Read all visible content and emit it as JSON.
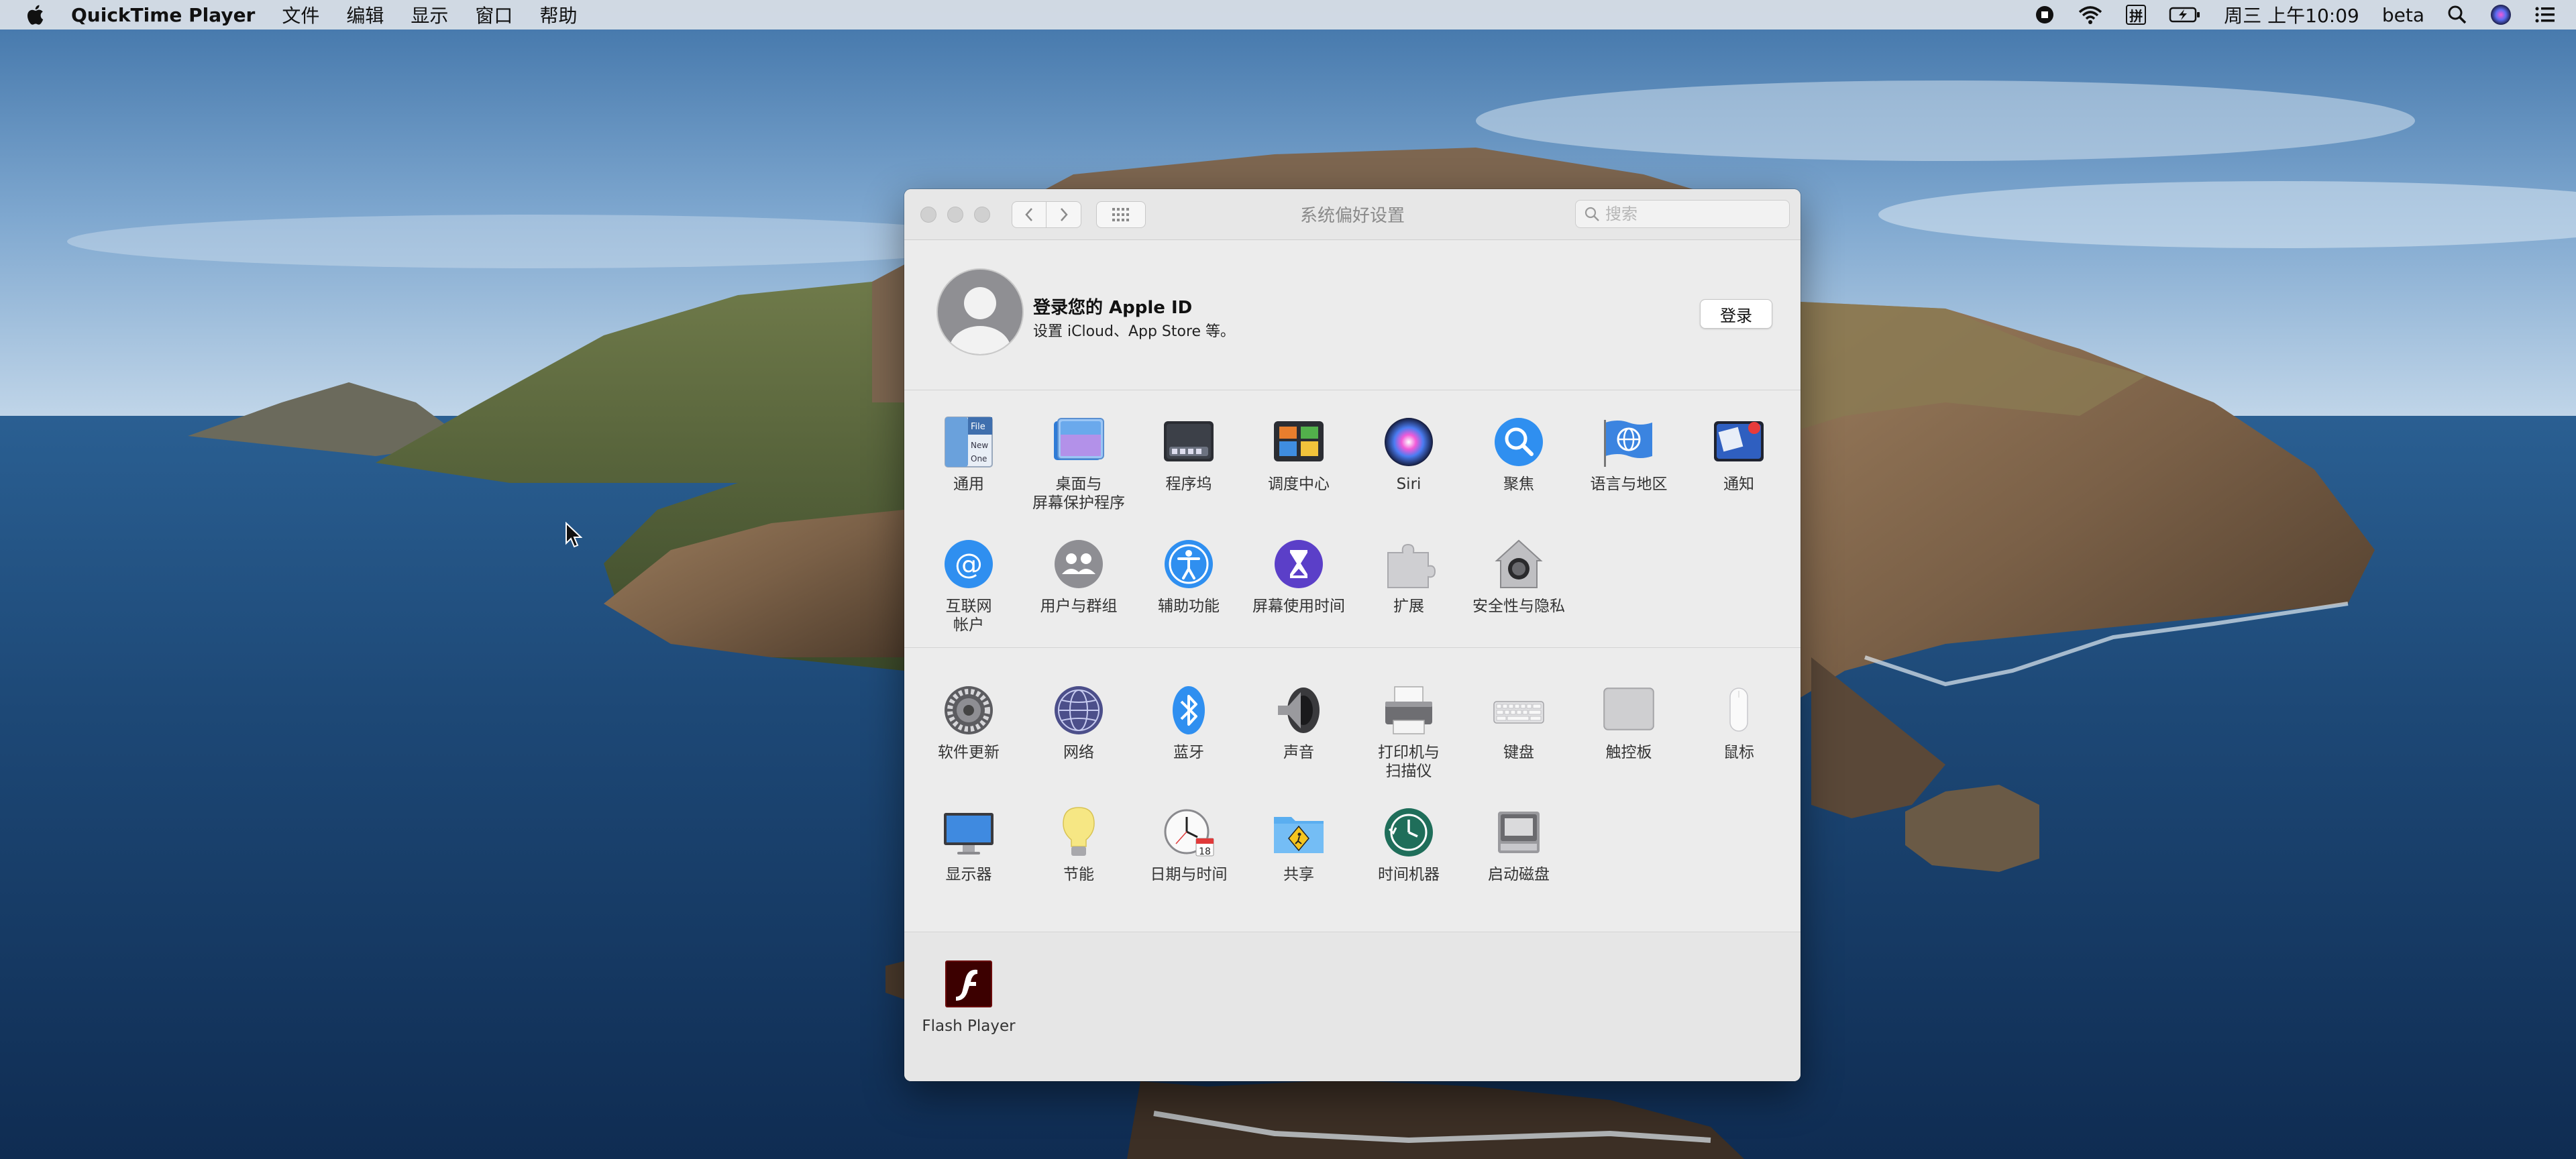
{
  "menubar": {
    "app_name": "QuickTime Player",
    "menus": [
      "文件",
      "编辑",
      "显示",
      "窗口",
      "帮助"
    ],
    "input_method": "拼",
    "clock": "周三 上午10:09",
    "user": "beta"
  },
  "window": {
    "title": "系统偏好设置",
    "search_placeholder": "搜索"
  },
  "apple_id": {
    "title": "登录您的 Apple ID",
    "subtitle": "设置 iCloud、App Store 等。",
    "login_label": "登录"
  },
  "prefs_row1": [
    "通用",
    "桌面与\n屏幕保护程序",
    "程序坞",
    "调度中心",
    "Siri",
    "聚焦",
    "语言与地区",
    "通知"
  ],
  "prefs_row2": [
    "互联网\n帐户",
    "用户与群组",
    "辅助功能",
    "屏幕使用时间",
    "扩展",
    "安全性与隐私"
  ],
  "prefs_row3": [
    "软件更新",
    "网络",
    "蓝牙",
    "声音",
    "打印机与\n扫描仪",
    "键盘",
    "触控板",
    "鼠标"
  ],
  "prefs_row4": [
    "显示器",
    "节能",
    "日期与时间",
    "共享",
    "时间机器",
    "启动磁盘"
  ],
  "prefs_other": [
    "Flash Player"
  ],
  "icon_text": {
    "general_file": "File",
    "general_new": "New",
    "general_one": "One",
    "calendar_day": "18"
  }
}
